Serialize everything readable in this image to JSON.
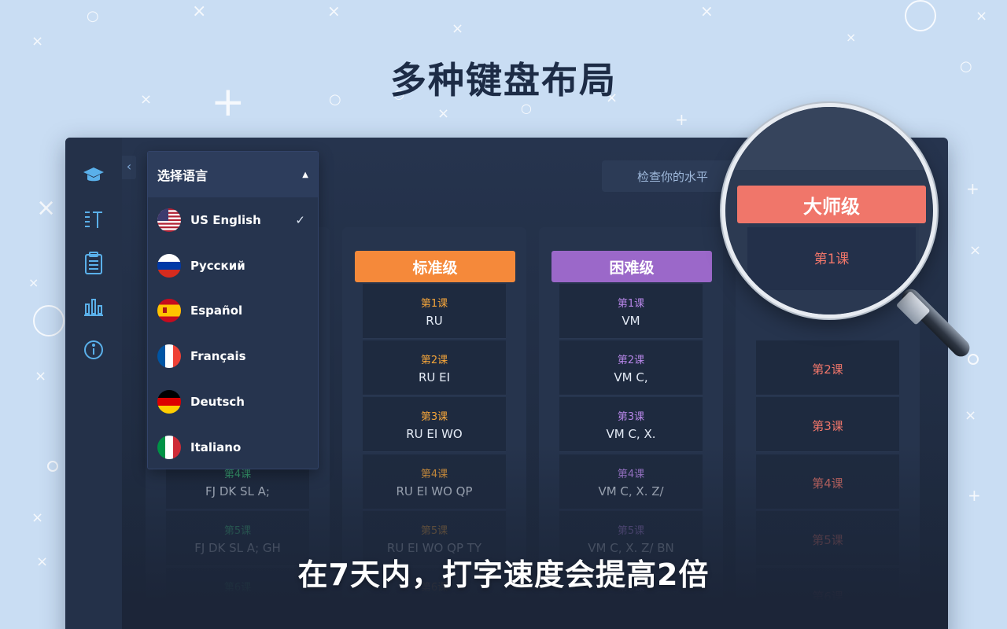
{
  "headline": "多种键盘布局",
  "tagline": "在7天内，打字速度会提高2倍",
  "app": {
    "check_level_label": "检查你的水平",
    "sidebar_icons": [
      "graduation-cap-icon",
      "typing-text-icon",
      "clipboard-icon",
      "bar-chart-icon",
      "info-icon"
    ],
    "collapse_glyph": "‹"
  },
  "language_menu": {
    "title": "选择语言",
    "items": [
      {
        "label": "US English",
        "selected": true
      },
      {
        "label": "Русский",
        "selected": false
      },
      {
        "label": "Español",
        "selected": false
      },
      {
        "label": "Français",
        "selected": false
      },
      {
        "label": "Deutsch",
        "selected": false
      },
      {
        "label": "Italiano",
        "selected": false
      }
    ]
  },
  "columns": [
    {
      "title": "",
      "color": "#3fbf7f",
      "lessons": [
        {
          "number": "第4课",
          "keys": "FJ DK SL A;"
        },
        {
          "number": "第5课",
          "keys": "FJ DK SL A; GH"
        },
        {
          "number": "第6课",
          "keys": ""
        }
      ]
    },
    {
      "title": "标准级",
      "color": "#f5893a",
      "lessons": [
        {
          "number": "第1课",
          "keys": "RU"
        },
        {
          "number": "第2课",
          "keys": "RU EI"
        },
        {
          "number": "第3课",
          "keys": "RU EI WO"
        },
        {
          "number": "第4课",
          "keys": "RU EI WO QP"
        },
        {
          "number": "第5课",
          "keys": "RU EI WO QP TY"
        },
        {
          "number": "第6课",
          "keys": ""
        }
      ]
    },
    {
      "title": "困难级",
      "color": "#9b68c9",
      "lessons": [
        {
          "number": "第1课",
          "keys": "VM"
        },
        {
          "number": "第2课",
          "keys": "VM C,"
        },
        {
          "number": "第3课",
          "keys": "VM C, X."
        },
        {
          "number": "第4课",
          "keys": "VM C, X. Z/"
        },
        {
          "number": "第5课",
          "keys": "VM C, X. Z/ BN"
        },
        {
          "number": "第6课",
          "keys": ""
        }
      ]
    },
    {
      "title": "大师级",
      "color": "#f0766a",
      "lessons": [
        {
          "number": "第1课",
          "keys": ""
        },
        {
          "number": "第2课",
          "keys": ""
        },
        {
          "number": "第3课",
          "keys": ""
        },
        {
          "number": "第4课",
          "keys": ""
        },
        {
          "number": "第5课",
          "keys": ""
        },
        {
          "number": "第6课",
          "keys": ""
        }
      ]
    }
  ]
}
